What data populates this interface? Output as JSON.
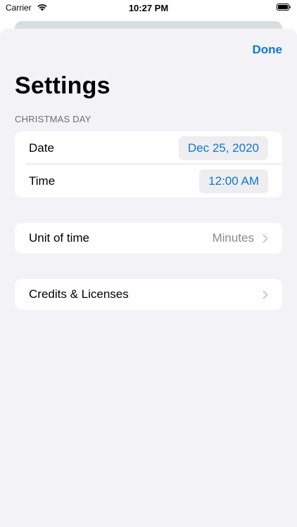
{
  "status_bar": {
    "carrier": "Carrier",
    "time": "10:27 PM",
    "wifi_icon": "wifi-icon",
    "battery_icon": "battery-icon"
  },
  "nav": {
    "done_label": "Done",
    "title": "Settings"
  },
  "event_section": {
    "header": "CHRISTMAS DAY",
    "date_label": "Date",
    "date_value": "Dec 25, 2020",
    "time_label": "Time",
    "time_value": "12:00 AM"
  },
  "unit_section": {
    "label": "Unit of time",
    "value": "Minutes",
    "chevron_icon": "chevron-right-icon"
  },
  "credits_section": {
    "label": "Credits & Licenses",
    "chevron_icon": "chevron-right-icon"
  },
  "colors": {
    "accent": "#0a7ad3",
    "background": "#f2f2f7",
    "secondary_text": "#8a8a8e"
  }
}
